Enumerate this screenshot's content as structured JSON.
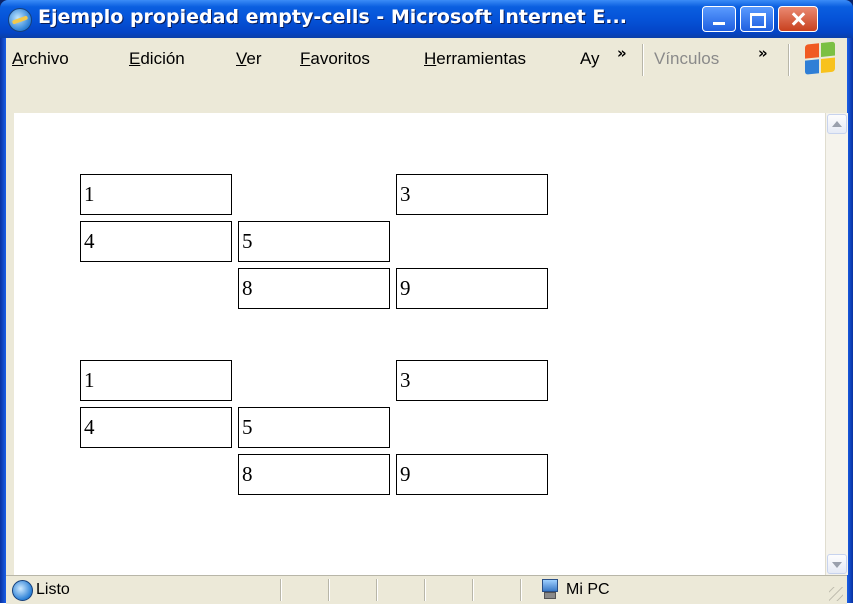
{
  "window": {
    "title": "Ejemplo propiedad empty-cells - Microsoft Internet E...",
    "icon": "ie-icon"
  },
  "menubar": {
    "items": [
      {
        "accel": "A",
        "rest": "rchivo"
      },
      {
        "accel": "E",
        "rest": "dición"
      },
      {
        "accel": "V",
        "rest": "er"
      },
      {
        "accel": "F",
        "rest": "avoritos"
      },
      {
        "accel": "H",
        "rest": "erramientas"
      },
      {
        "accel": "A",
        "rest": "y"
      }
    ],
    "overflow_chevron": "»",
    "links_label": "Vínculos",
    "links_chevron": "»"
  },
  "tables": [
    {
      "rows": [
        [
          "1",
          "",
          "3"
        ],
        [
          "4",
          "5",
          ""
        ],
        [
          "",
          "8",
          "9"
        ]
      ]
    },
    {
      "rows": [
        [
          "1",
          "",
          "3"
        ],
        [
          "4",
          "5",
          ""
        ],
        [
          "",
          "8",
          "9"
        ]
      ]
    }
  ],
  "statusbar": {
    "status_text": "Listo",
    "zone_text": "Mi PC"
  }
}
